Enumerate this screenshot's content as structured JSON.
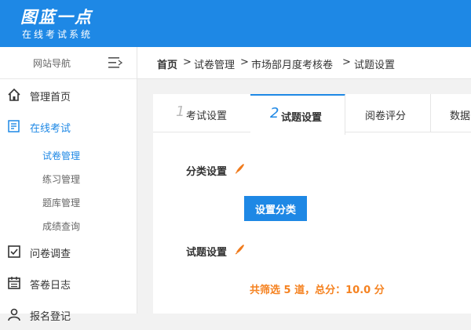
{
  "header": {
    "logo_title": "图蓝一点",
    "logo_subtitle": "在线考试系统"
  },
  "sidebar": {
    "nav_label": "网站导航",
    "items": [
      {
        "label": "管理首页",
        "icon": "home-icon"
      },
      {
        "label": "在线考试",
        "icon": "exam-icon",
        "active": true,
        "children": [
          {
            "label": "试卷管理",
            "active": true
          },
          {
            "label": "练习管理"
          },
          {
            "label": "题库管理"
          },
          {
            "label": "成绩查询"
          }
        ]
      },
      {
        "label": "问卷调查",
        "icon": "checkbox-icon"
      },
      {
        "label": "答卷日志",
        "icon": "calendar-icon"
      },
      {
        "label": "报名登记",
        "icon": "register-icon"
      }
    ]
  },
  "breadcrumb": {
    "home": "首页",
    "sep": ">",
    "level1": "试卷管理",
    "level2": "市场部月度考核卷",
    "level3": "试题设置"
  },
  "tabs": [
    {
      "num": "1",
      "label": "考试设置"
    },
    {
      "num": "2",
      "label": "试题设置",
      "active": true
    },
    {
      "num": "",
      "label": "阅卷评分"
    },
    {
      "num": "",
      "label": "数据"
    }
  ],
  "sections": {
    "category_label": "分类设置",
    "category_button": "设置分类",
    "questions_label": "试题设置"
  },
  "summary": "共筛选 5 道，总分：10.0 分",
  "colors": {
    "accent": "#1e88e5",
    "highlight": "#f58220",
    "pen": "#f07b1d"
  }
}
